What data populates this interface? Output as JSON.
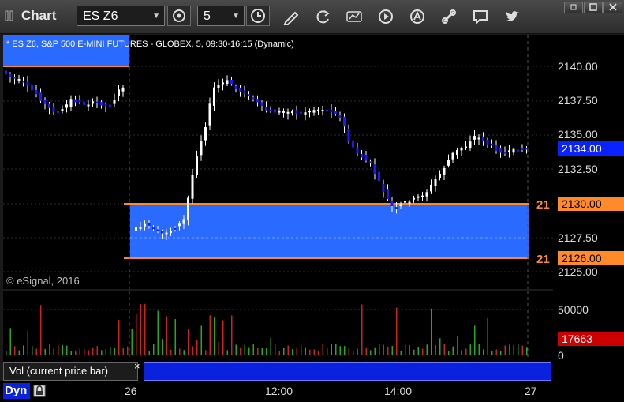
{
  "toolbar": {
    "app_title": "Chart",
    "symbol": "ES Z6",
    "interval": "5"
  },
  "chart": {
    "header": "* ES Z6, S&P 500 E-MINI FUTURES - GLOBEX, 5, 09:30-16:15 (Dynamic)",
    "copyright": "© eSignal, 2016",
    "current_price": "2134.00",
    "line_upper_price": "2130.00",
    "line_lower_price": "2126.00",
    "line_upper_marker": "21",
    "line_lower_marker": "21",
    "colors": {
      "up": "#ffffff",
      "down": "#1a1aff",
      "zone": "#2a6aff",
      "line": "#ff8a2a"
    }
  },
  "price_axis": {
    "ticks": [
      "2140.00",
      "2137.50",
      "2135.00",
      "2132.50",
      "2127.50",
      "2125.00"
    ]
  },
  "volume": {
    "label": "Vol (current price bar)",
    "close_symbol": "×",
    "axis_ticks": [
      "50000",
      "0"
    ],
    "current_value": "17663"
  },
  "time_axis": {
    "labels": [
      "26",
      "12:00",
      "14:00",
      "27"
    ]
  },
  "footer": {
    "label": "Dyn"
  }
}
